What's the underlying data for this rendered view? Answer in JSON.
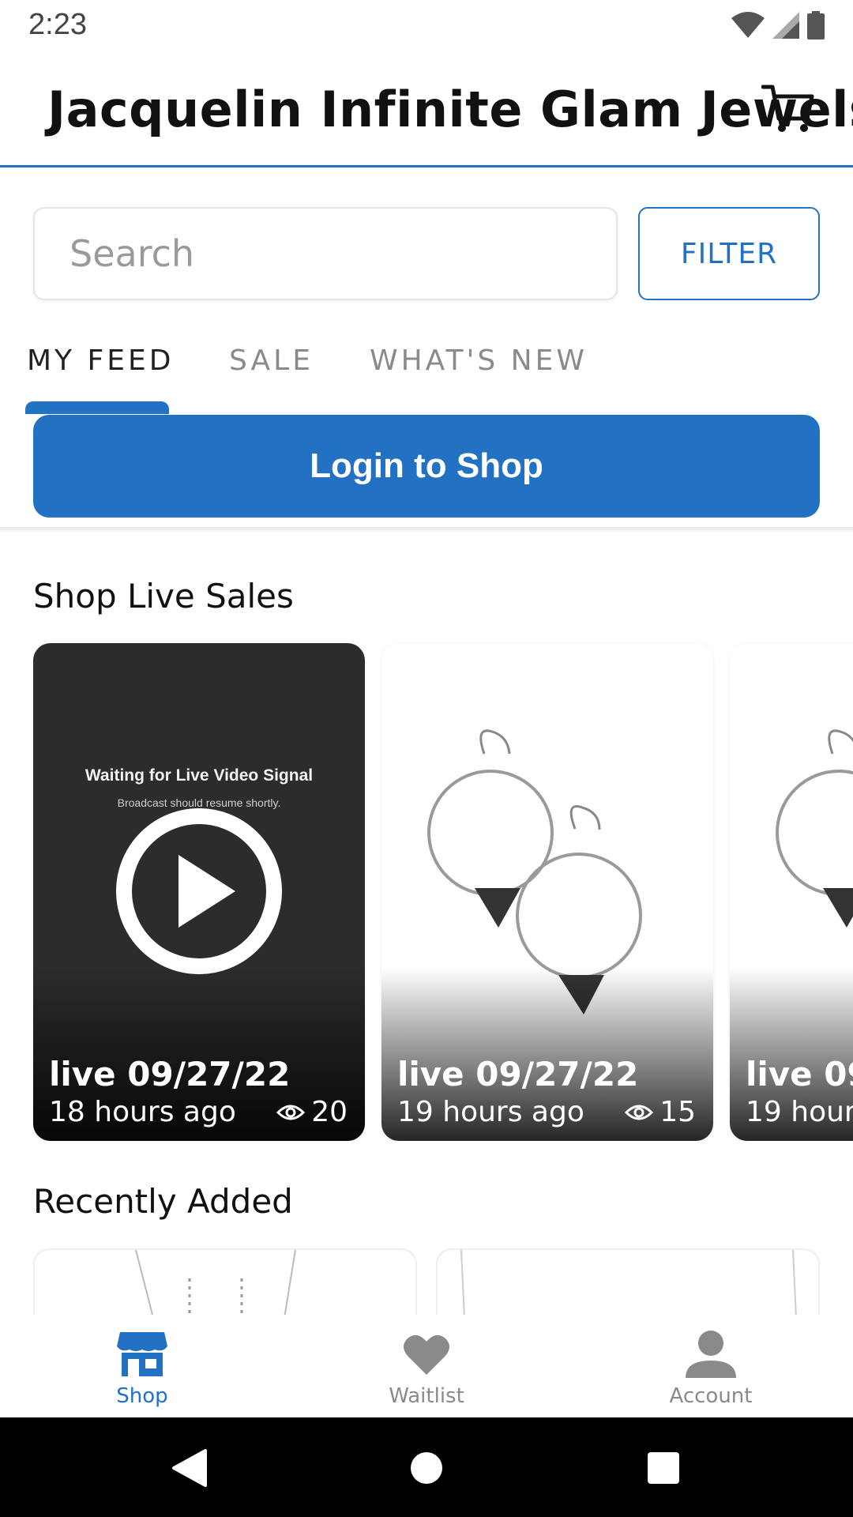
{
  "status_bar": {
    "time": "2:23"
  },
  "header": {
    "title": "Jacquelin Infinite Glam Jewels"
  },
  "search": {
    "placeholder": "Search",
    "value": ""
  },
  "filter_label": "FILTER",
  "tabs": [
    {
      "label": "MY FEED",
      "active": true
    },
    {
      "label": "SALE",
      "active": false
    },
    {
      "label": "WHAT'S NEW",
      "active": false
    }
  ],
  "login_label": "Login to Shop",
  "live_section": {
    "title": "Shop Live Sales",
    "cards": [
      {
        "title": "live 09/27/22",
        "time": "18 hours ago",
        "views": "20",
        "thumbnail": "live-video-placeholder",
        "waiting_title": "Waiting for Live Video Signal",
        "waiting_subtitle": "Broadcast should resume shortly."
      },
      {
        "title": "live 09/27/22",
        "time": "19 hours ago",
        "views": "15",
        "thumbnail": "earrings-photo"
      },
      {
        "title": "live 09/",
        "time": "19 hours",
        "thumbnail": "earrings-photo"
      }
    ]
  },
  "recent_section": {
    "title": "Recently Added"
  },
  "bottom_nav": [
    {
      "label": "Shop",
      "icon": "store-icon",
      "active": true
    },
    {
      "label": "Waitlist",
      "icon": "heart-icon",
      "active": false
    },
    {
      "label": "Account",
      "icon": "person-icon",
      "active": false
    }
  ],
  "colors": {
    "accent": "#2271c2",
    "inactive": "#8a8a8a",
    "dark_card": "#2c2c2c"
  }
}
